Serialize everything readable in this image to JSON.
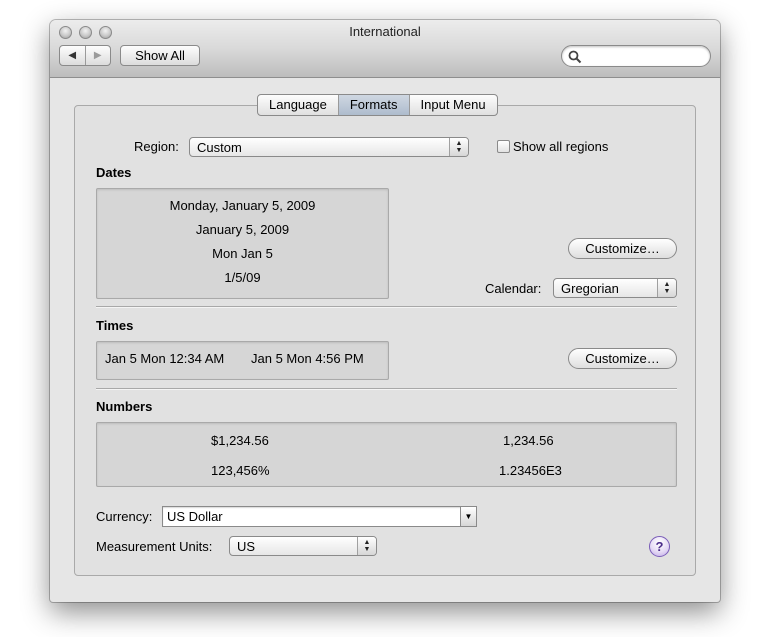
{
  "window": {
    "title": "International"
  },
  "toolbar": {
    "back_icon": "◀",
    "forward_icon": "▶",
    "show_all_label": "Show All",
    "search": {
      "placeholder": "",
      "value": ""
    }
  },
  "tabs": [
    {
      "label": "Language",
      "active": false
    },
    {
      "label": "Formats",
      "active": true
    },
    {
      "label": "Input Menu",
      "active": false
    }
  ],
  "region": {
    "label": "Region:",
    "value": "Custom",
    "show_all_label": "Show all regions",
    "show_all_checked": false
  },
  "dates": {
    "heading": "Dates",
    "examples": [
      "Monday, January 5, 2009",
      "January 5, 2009",
      "Mon Jan 5",
      "1/5/09"
    ],
    "customize_label": "Customize…",
    "calendar_label": "Calendar:",
    "calendar_value": "Gregorian"
  },
  "times": {
    "heading": "Times",
    "examples": [
      "Jan 5 Mon 12:34 AM",
      "Jan 5 Mon 4:56 PM"
    ],
    "customize_label": "Customize…"
  },
  "numbers": {
    "heading": "Numbers",
    "currency_example": "$1,234.56",
    "decimal_example": "1,234.56",
    "percent_example": "123,456%",
    "scientific_example": "1.23456E3"
  },
  "currency": {
    "label": "Currency:",
    "value": "US Dollar"
  },
  "measurement": {
    "label": "Measurement Units:",
    "value": "US"
  },
  "help": {
    "label": "?"
  }
}
